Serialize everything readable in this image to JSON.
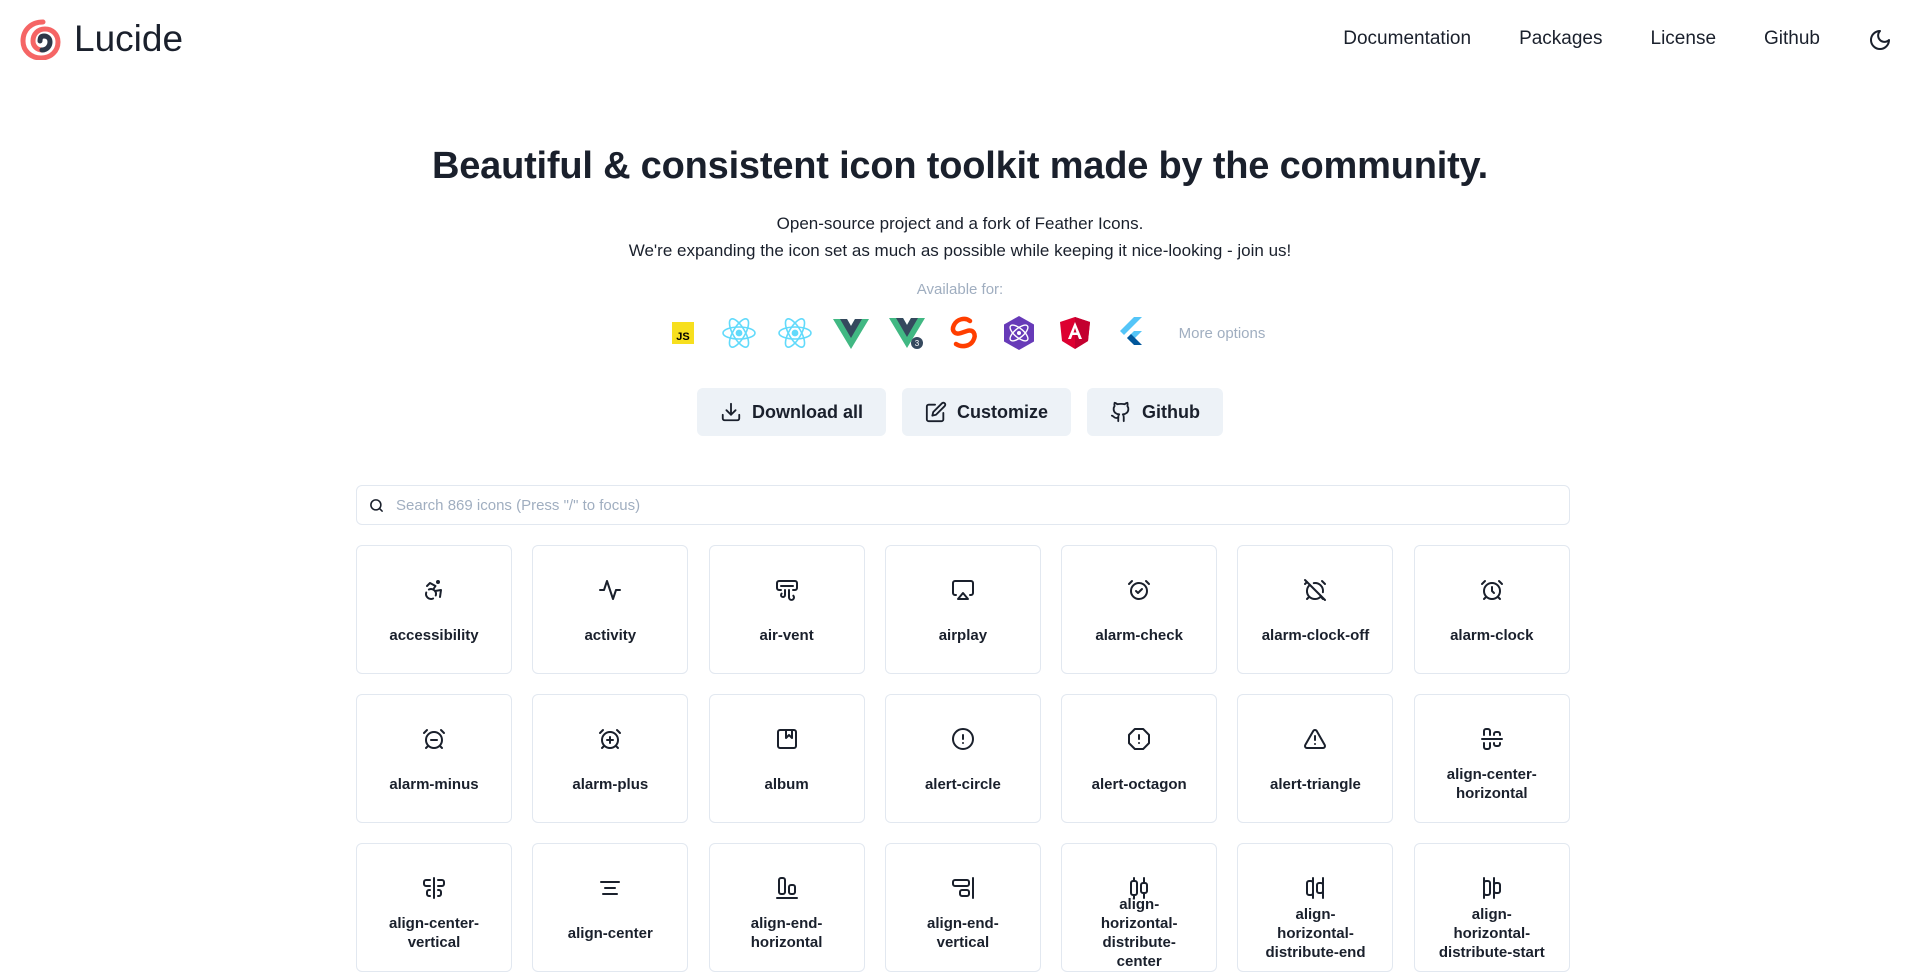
{
  "brand": {
    "name": "Lucide",
    "colors": {
      "spiral_outer": "#f56565",
      "spiral_inner": "#2d3748"
    }
  },
  "nav": {
    "items": [
      "Documentation",
      "Packages",
      "License",
      "Github"
    ],
    "theme_toggle_icon": "moon-icon"
  },
  "hero": {
    "title": "Beautiful & consistent icon toolkit made by the community.",
    "subtitle_1": "Open-source project and a fork of Feather Icons.",
    "subtitle_2": "We're expanding the icon set as much as possible while keeping it nice-looking - join us!",
    "available_for": "Available for:"
  },
  "frameworks": {
    "items": [
      "js-icon",
      "react-icon",
      "react-native-icon",
      "vue-icon",
      "vue3-icon",
      "svelte-icon",
      "preact-icon",
      "angular-icon",
      "flutter-icon"
    ],
    "more_label": "More options"
  },
  "actions": {
    "download": "Download all",
    "customize": "Customize",
    "github": "Github"
  },
  "search": {
    "placeholder": "Search 869 icons (Press \"/\" to focus)"
  },
  "icons": [
    {
      "name": "accessibility",
      "icon": "accessibility-icon"
    },
    {
      "name": "activity",
      "icon": "activity-icon"
    },
    {
      "name": "air-vent",
      "icon": "air-vent-icon"
    },
    {
      "name": "airplay",
      "icon": "airplay-icon"
    },
    {
      "name": "alarm-check",
      "icon": "alarm-check-icon"
    },
    {
      "name": "alarm-clock-off",
      "icon": "alarm-clock-off-icon"
    },
    {
      "name": "alarm-clock",
      "icon": "alarm-clock-icon"
    },
    {
      "name": "alarm-minus",
      "icon": "alarm-minus-icon"
    },
    {
      "name": "alarm-plus",
      "icon": "alarm-plus-icon"
    },
    {
      "name": "album",
      "icon": "album-icon"
    },
    {
      "name": "alert-circle",
      "icon": "alert-circle-icon"
    },
    {
      "name": "alert-octagon",
      "icon": "alert-octagon-icon"
    },
    {
      "name": "alert-triangle",
      "icon": "alert-triangle-icon"
    },
    {
      "name": "align-center-horizontal",
      "icon": "align-center-horizontal-icon"
    },
    {
      "name": "align-center-vertical",
      "icon": "align-center-vertical-icon"
    },
    {
      "name": "align-center",
      "icon": "align-center-icon"
    },
    {
      "name": "align-end-horizontal",
      "icon": "align-end-horizontal-icon"
    },
    {
      "name": "align-end-vertical",
      "icon": "align-end-vertical-icon"
    },
    {
      "name": "align-horizontal-distribute-center",
      "icon": "align-horizontal-distribute-center-icon"
    },
    {
      "name": "align-horizontal-distribute-end",
      "icon": "align-horizontal-distribute-end-icon"
    },
    {
      "name": "align-horizontal-distribute-start",
      "icon": "align-horizontal-distribute-start-icon"
    }
  ]
}
